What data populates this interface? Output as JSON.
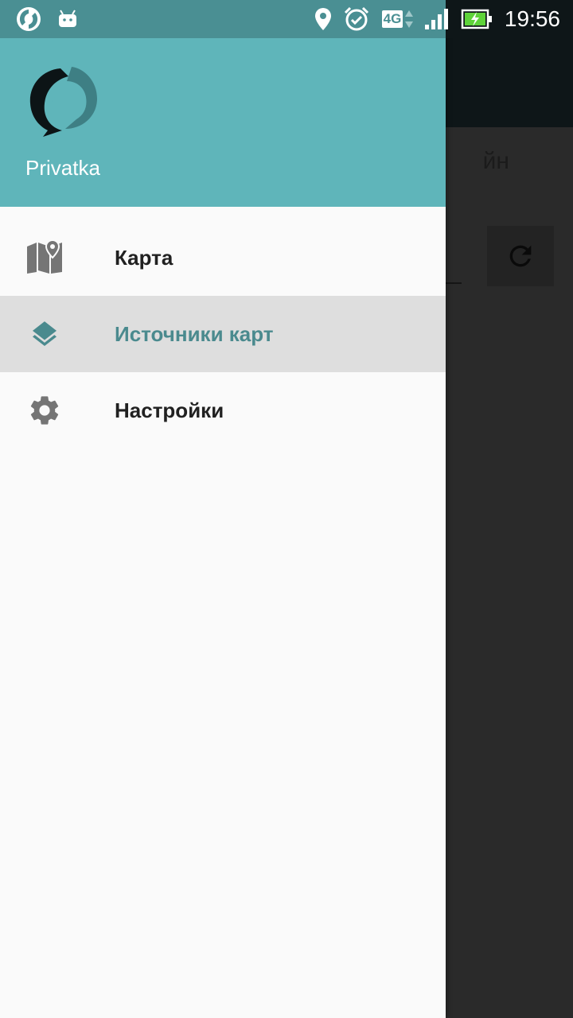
{
  "status_bar": {
    "time": "19:56",
    "network": "4G",
    "icons": [
      "app-notification-icon",
      "android-icon",
      "location-icon",
      "alarm-icon",
      "signal-icon",
      "battery-charging-icon"
    ]
  },
  "background": {
    "title_fragment": "йн"
  },
  "drawer": {
    "app_name": "Privatka",
    "items": [
      {
        "label": "Карта",
        "icon": "map-icon",
        "active": false
      },
      {
        "label": "Источники карт",
        "icon": "layers-icon",
        "active": true
      },
      {
        "label": "Настройки",
        "icon": "gear-icon",
        "active": false
      }
    ]
  },
  "colors": {
    "header": "#5fb5ba",
    "accent": "#4a8a8e",
    "active_bg": "#dedede",
    "drawer_bg": "#fafafa",
    "scrim": "#2a2a2a"
  }
}
